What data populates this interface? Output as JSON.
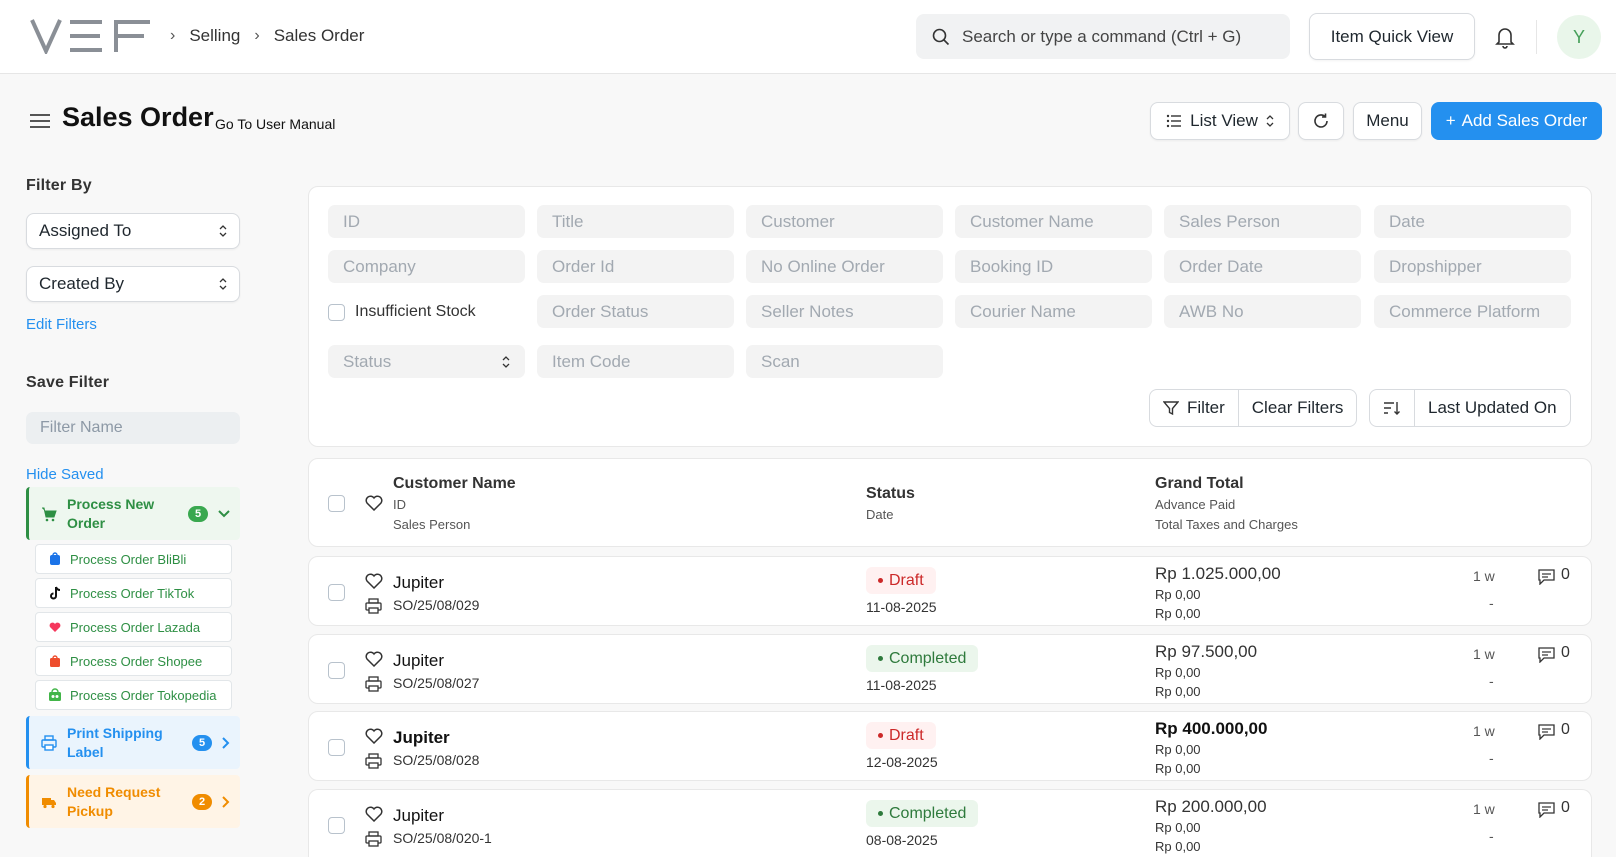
{
  "header": {
    "logo_text": "VEF",
    "breadcrumbs": [
      "Selling",
      "Sales Order"
    ],
    "search_placeholder": "Search or type a command (Ctrl + G)",
    "quick_view_label": "Item Quick View",
    "avatar_initial": "Y"
  },
  "page": {
    "title": "Sales Order",
    "manual_link": "Go To User Manual",
    "list_view_label": "List View",
    "menu_label": "Menu",
    "add_label": "Add Sales Order"
  },
  "sidebar": {
    "filter_by_label": "Filter By",
    "assigned_to": "Assigned To",
    "created_by": "Created By",
    "edit_filters": "Edit Filters",
    "save_filter_label": "Save Filter",
    "filter_name_placeholder": "Filter Name",
    "hide_saved": "Hide Saved",
    "groups": [
      {
        "label": "Process New Order",
        "count": "5",
        "color": "#2e8f44",
        "bg": "#eef7ef",
        "badge": "#39a84f"
      },
      {
        "label": "Print Shipping Label",
        "count": "5",
        "color": "#2490ef",
        "bg": "#eaf4fd",
        "badge": "#2490ef"
      },
      {
        "label": "Need Request Pickup",
        "count": "2",
        "color": "#f08c00",
        "bg": "#fff4e6",
        "badge": "#f08c00"
      }
    ],
    "sub_items": [
      "Process Order BliBli",
      "Process Order TikTok",
      "Process Order Lazada",
      "Process Order Shopee",
      "Process Order Tokopedia"
    ]
  },
  "filters": {
    "row1": [
      "ID",
      "Title",
      "Customer",
      "Customer Name",
      "Sales Person",
      "Date"
    ],
    "row2": [
      "Company",
      "Order Id",
      "No Online Order",
      "Booking ID",
      "Order Date",
      "Dropshipper"
    ],
    "row3_check": "Insufficient Stock",
    "row3": [
      "Order Status",
      "Seller Notes",
      "Courier Name",
      "AWB No",
      "Commerce Platform"
    ],
    "status_label": "Status",
    "row4": [
      "Item Code",
      "Scan"
    ],
    "filter_btn": "Filter",
    "clear_btn": "Clear Filters",
    "sort_label": "Last Updated On"
  },
  "list": {
    "head": {
      "customer_name": "Customer Name",
      "id": "ID",
      "sales_person": "Sales Person",
      "status": "Status",
      "date": "Date",
      "grand_total": "Grand Total",
      "advance_paid": "Advance Paid",
      "taxes": "Total Taxes and Charges"
    },
    "rows": [
      {
        "customer": "Jupiter",
        "id": "SO/25/08/029",
        "status": "Draft",
        "date": "11-08-2025",
        "total": "Rp 1.025.000,00",
        "advance": "Rp 0,00",
        "taxes": "Rp 0,00",
        "age": "1 w",
        "dash": "-",
        "comments": "0"
      },
      {
        "customer": "Jupiter",
        "id": "SO/25/08/027",
        "status": "Completed",
        "date": "11-08-2025",
        "total": "Rp 97.500,00",
        "advance": "Rp 0,00",
        "taxes": "Rp 0,00",
        "age": "1 w",
        "dash": "-",
        "comments": "0"
      },
      {
        "customer": "Jupiter",
        "id": "SO/25/08/028",
        "status": "Draft",
        "date": "12-08-2025",
        "total": "Rp 400.000,00",
        "advance": "Rp 0,00",
        "taxes": "Rp 0,00",
        "age": "1 w",
        "dash": "-",
        "comments": "0"
      },
      {
        "customer": "Jupiter",
        "id": "SO/25/08/020-1",
        "status": "Completed",
        "date": "08-08-2025",
        "total": "Rp 200.000,00",
        "advance": "Rp 0,00",
        "taxes": "Rp 0,00",
        "age": "1 w",
        "dash": "-",
        "comments": "0"
      }
    ]
  }
}
